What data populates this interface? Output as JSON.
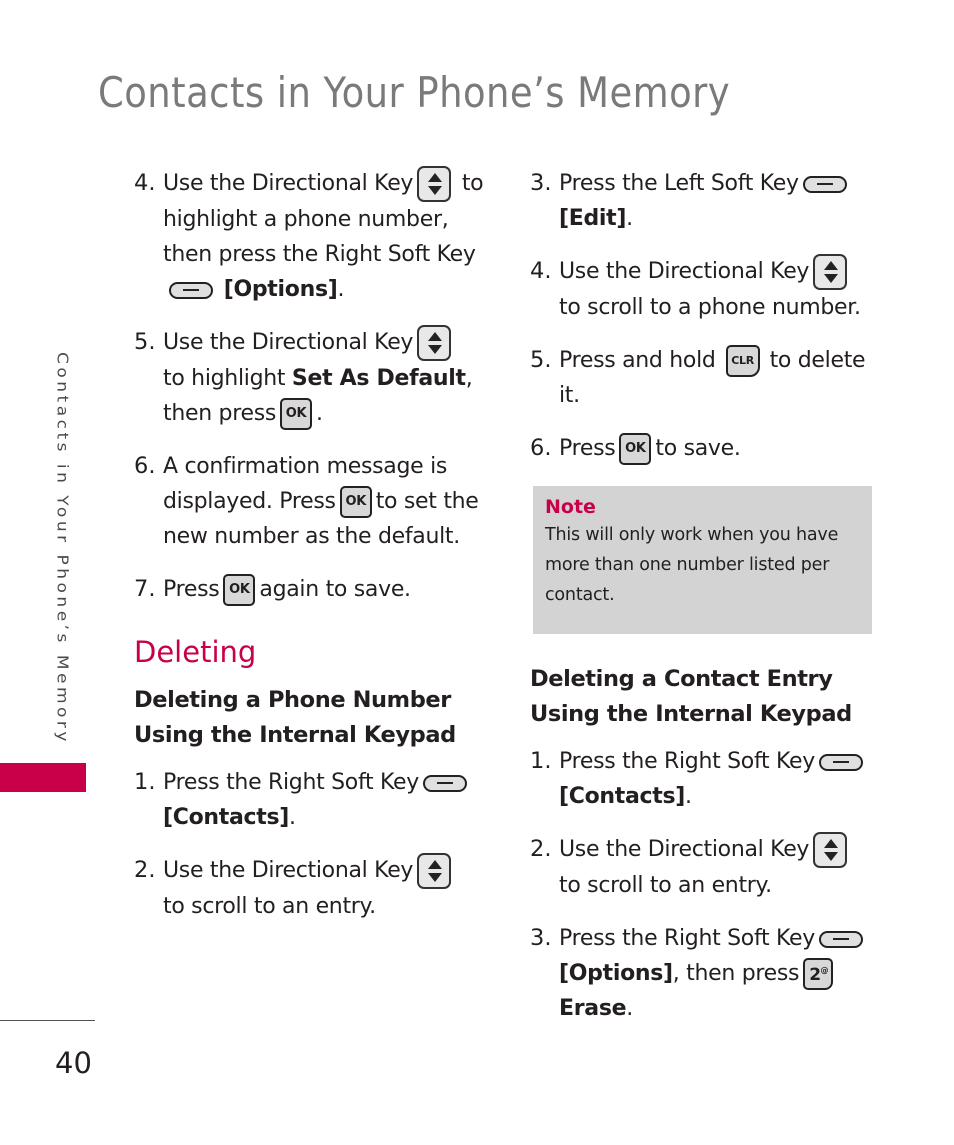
{
  "page": {
    "title": "Contacts in Your Phone’s Memory",
    "side_tab_text": "Contacts in Your Phone’s Memory",
    "page_number": "40",
    "accent_color": "#c8004a"
  },
  "left_column": {
    "steps_top": [
      {
        "num": "4.",
        "parts": [
          "Use the Directional Key",
          "to highlight a phone number, then press the Right Soft Key",
          "[Options]",
          "."
        ]
      },
      {
        "num": "5.",
        "parts": [
          "Use the Directional Key",
          "to highlight ",
          "Set As Default",
          ", then press",
          "."
        ]
      },
      {
        "num": "6.",
        "parts": [
          "A confirmation message is displayed. Press",
          "to set the new number as the default."
        ]
      },
      {
        "num": "7.",
        "parts": [
          "Press",
          "again to save."
        ]
      }
    ],
    "section_heading": "Deleting",
    "subheading": "Deleting a Phone Number Using the Internal Keypad",
    "steps_bottom": [
      {
        "num": "1.",
        "parts": [
          "Press the Right Soft Key",
          "[Contacts]",
          "."
        ]
      },
      {
        "num": "2.",
        "parts": [
          "Use the Directional Key",
          "to scroll to an entry."
        ]
      }
    ]
  },
  "right_column": {
    "steps_top": [
      {
        "num": "3.",
        "parts": [
          "Press the Left Soft Key",
          "[Edit]",
          "."
        ]
      },
      {
        "num": "4.",
        "parts": [
          "Use the Directional Key",
          "to scroll to a phone number."
        ]
      },
      {
        "num": "5.",
        "parts": [
          "Press and hold",
          "to delete it."
        ]
      },
      {
        "num": "6.",
        "parts": [
          "Press",
          "to save."
        ]
      }
    ],
    "note": {
      "heading": "Note",
      "text": "This will only work when you have more than one number listed per contact."
    },
    "subheading": "Deleting a Contact Entry Using the Internal Keypad",
    "steps_bottom": [
      {
        "num": "1.",
        "parts": [
          "Press the Right Soft Key",
          "[Contacts]",
          "."
        ]
      },
      {
        "num": "2.",
        "parts": [
          "Use the Directional Key",
          "to scroll to an entry."
        ]
      },
      {
        "num": "3.",
        "parts": [
          "Press the Right Soft Key",
          "[Options]",
          ", then press",
          "Erase",
          "."
        ]
      }
    ]
  },
  "keys": {
    "ok_label": "OK",
    "clr_label": "CLR",
    "num2_label": "2",
    "num2_sup": "@",
    "icons": [
      "directional-key-icon",
      "soft-key-icon",
      "ok-key-icon",
      "clr-key-icon",
      "number-2-key-icon"
    ]
  }
}
